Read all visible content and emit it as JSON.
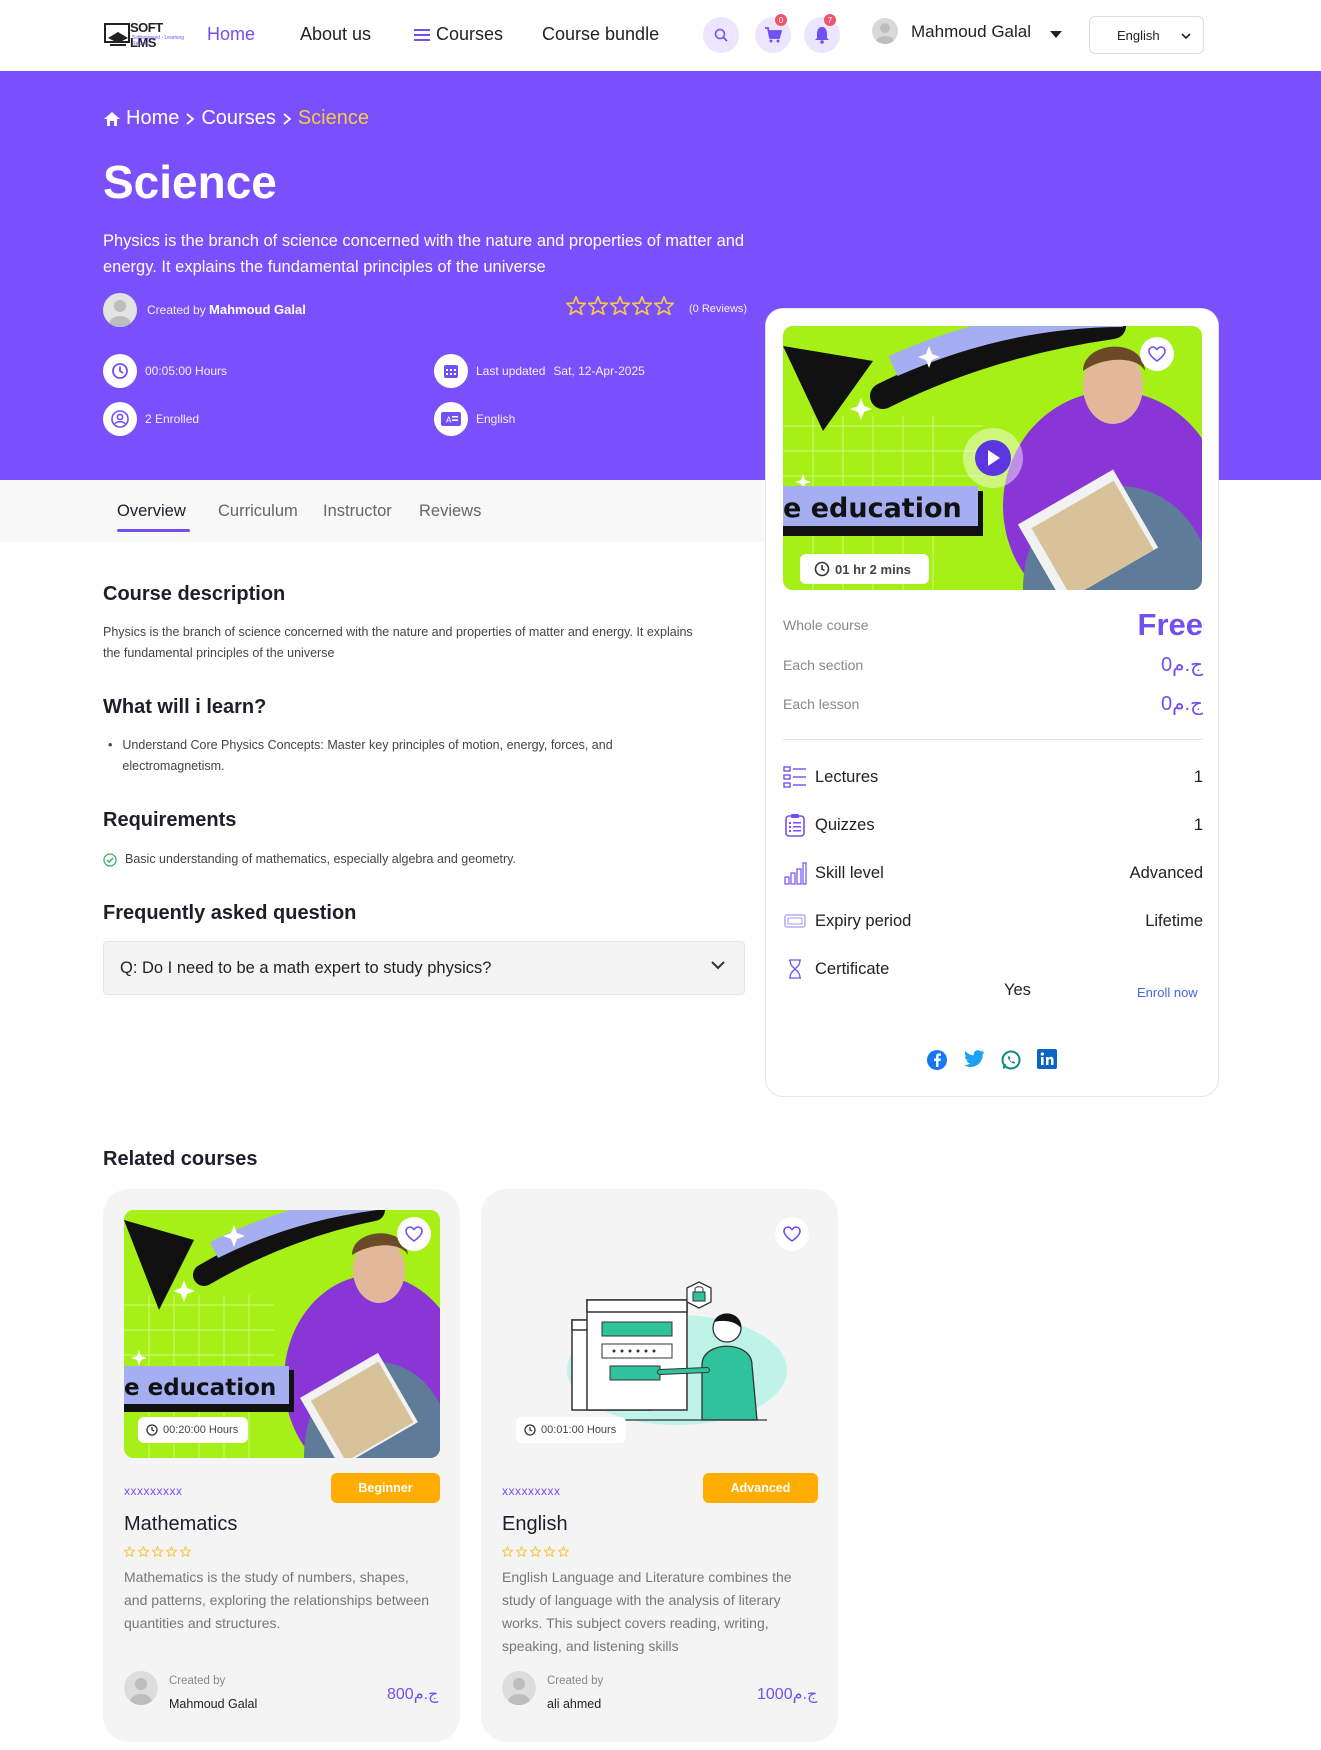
{
  "nav": {
    "logo_text": "SOFT LMS",
    "logo_sub": "Softpowered - Learning Results",
    "home": "Home",
    "about": "About us",
    "courses": "Courses",
    "bundle": "Course bundle",
    "cart_count": "0",
    "notif_count": "7",
    "user_name": "Mahmoud Galal",
    "language": "English"
  },
  "breadcrumb": {
    "home": "Home",
    "courses": "Courses",
    "current": "Science"
  },
  "course": {
    "title": "Science",
    "description": "Physics is the branch of science concerned with the nature and properties of matter and energy. It explains the fundamental principles of the universe",
    "created_by_label": "Created by",
    "creator": "Mahmoud Galal",
    "rating": 0,
    "reviews": "(0 Reviews)",
    "duration": "00:05:00 Hours",
    "last_updated_label": "Last updated",
    "last_updated": "Sat, 12-Apr-2025",
    "enrolled": "2 Enrolled",
    "language": "English"
  },
  "tabs": [
    "Overview",
    "Curriculum",
    "Instructor",
    "Reviews"
  ],
  "overview": {
    "desc_heading": "Course description",
    "desc_text": "Physics is the branch of science concerned with the nature and properties of matter and energy. It explains the fundamental principles of the universe",
    "learn_heading": "What will i learn?",
    "learn_item": "Understand Core Physics Concepts: Master key principles of motion, energy, forces, and electromagnetism.",
    "req_heading": "Requirements",
    "req_item": "Basic understanding of mathematics, especially algebra and geometry.",
    "faq_heading": "Frequently asked question",
    "faq_q": "Q: Do I need to be a math expert to study physics?"
  },
  "sidebar": {
    "thumb_text": "e education",
    "thumb_time": "01 hr 2 mins",
    "whole_label": "Whole course",
    "whole_price": "Free",
    "section_label": "Each section",
    "section_price": "0ج.م",
    "lesson_label": "Each lesson",
    "lesson_price": "0ج.م",
    "lectures_label": "Lectures",
    "lectures": "1",
    "quizzes_label": "Quizzes",
    "quizzes": "1",
    "skill_label": "Skill level",
    "skill": "Advanced",
    "expiry_label": "Expiry period",
    "expiry": "Lifetime",
    "cert_label": "Certificate",
    "cert": "Yes",
    "enroll": "Enroll now"
  },
  "related": {
    "heading": "Related courses",
    "cards": [
      {
        "thumb_text": "e education",
        "hours": "00:20:00 Hours",
        "subject": "xxxxxxxxx",
        "level": "Beginner",
        "title": "Mathematics",
        "desc": "Mathematics is the study of numbers, shapes, and patterns, exploring the relationships between quantities and structures.",
        "created_by": "Created by",
        "author": "Mahmoud Galal",
        "price": "800ج.م"
      },
      {
        "hours": "00:01:00 Hours",
        "subject": "xxxxxxxxx",
        "level": "Advanced",
        "title": "English",
        "desc": "English Language and Literature combines the study of language with the analysis of literary works. This subject covers reading, writing, speaking, and listening skills",
        "created_by": "Created by",
        "author": "ali ahmed",
        "price": "1000ج.م"
      }
    ]
  },
  "colors": {
    "primary": "#7950fb",
    "accent": "#7150f3",
    "star": "#f7c948",
    "badge": "#ffae00"
  }
}
